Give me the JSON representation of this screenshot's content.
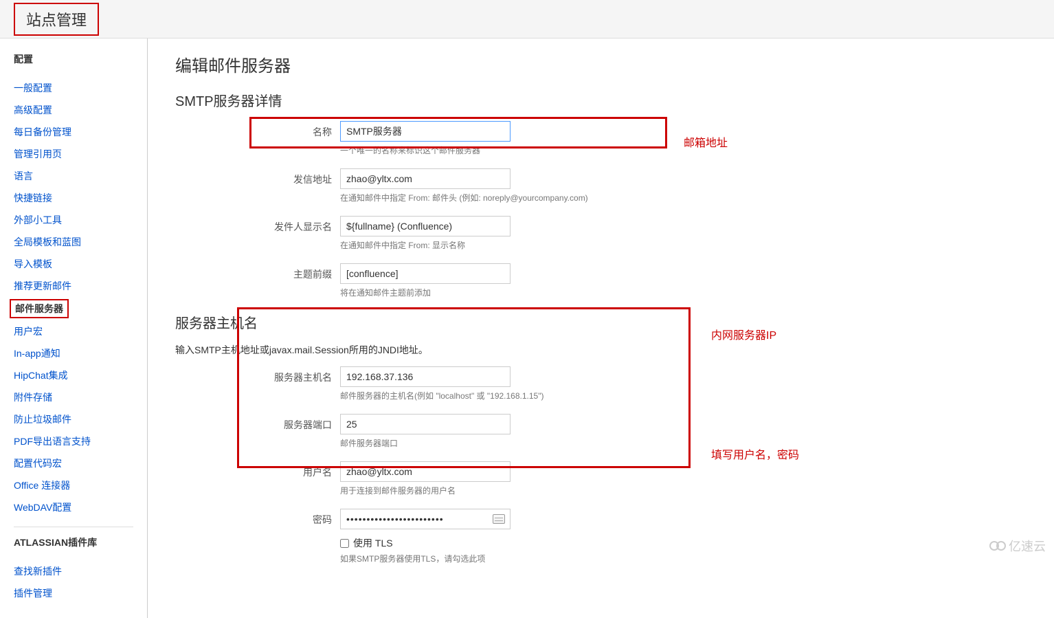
{
  "header": {
    "title": "站点管理"
  },
  "sidebar": {
    "section1_title": "配置",
    "items1": [
      "一般配置",
      "高级配置",
      "每日备份管理",
      "管理引用页",
      "语言",
      "快捷链接",
      "外部小工具",
      "全局模板和蓝图",
      "导入模板",
      "推荐更新邮件",
      "邮件服务器",
      "用户宏",
      "In-app通知",
      "HipChat集成",
      "附件存储",
      "防止垃圾邮件",
      "PDF导出语言支持",
      "配置代码宏",
      "Office 连接器",
      "WebDAV配置"
    ],
    "active_index": 10,
    "section2_title": "ATLASSIAN插件库",
    "items2": [
      "查找新插件",
      "插件管理"
    ]
  },
  "content": {
    "heading": "编辑邮件服务器",
    "section1_title": "SMTP服务器详情",
    "section2_title": "服务器主机名",
    "section2_help": "输入SMTP主机地址或javax.mail.Session所用的JNDI地址。",
    "fields": {
      "name": {
        "label": "名称",
        "value": "SMTP服务器",
        "hint": "一个唯一的名称来标识这个邮件服务器"
      },
      "from_addr": {
        "label": "发信地址",
        "value": "zhao@yltx.com",
        "hint": "在通知邮件中指定 From: 邮件头 (例如: noreply@yourcompany.com)"
      },
      "from_name": {
        "label": "发件人显示名",
        "value": "${fullname} (Confluence)",
        "hint": "在通知邮件中指定 From: 显示名称"
      },
      "subject_prefix": {
        "label": "主题前缀",
        "value": "[confluence]",
        "hint": "将在通知邮件主题前添加"
      },
      "hostname": {
        "label": "服务器主机名",
        "value": "192.168.37.136",
        "hint": "邮件服务器的主机名(例如 \"localhost\" 或 \"192.168.1.15\")"
      },
      "port": {
        "label": "服务器端口",
        "value": "25",
        "hint": "邮件服务器端口"
      },
      "username": {
        "label": "用户名",
        "value": "zhao@yltx.com",
        "hint": "用于连接到邮件服务器的用户名"
      },
      "password": {
        "label": "密码",
        "value": "••••••••••••••••••••••••"
      },
      "tls": {
        "label": "使用 TLS",
        "hint": "如果SMTP服务器使用TLS，请勾选此项"
      }
    }
  },
  "annotations": {
    "email_addr": "邮箱地址",
    "internal_ip": "内网服务器IP",
    "user_pass": "填写用户名，密码"
  },
  "watermark": "亿速云"
}
